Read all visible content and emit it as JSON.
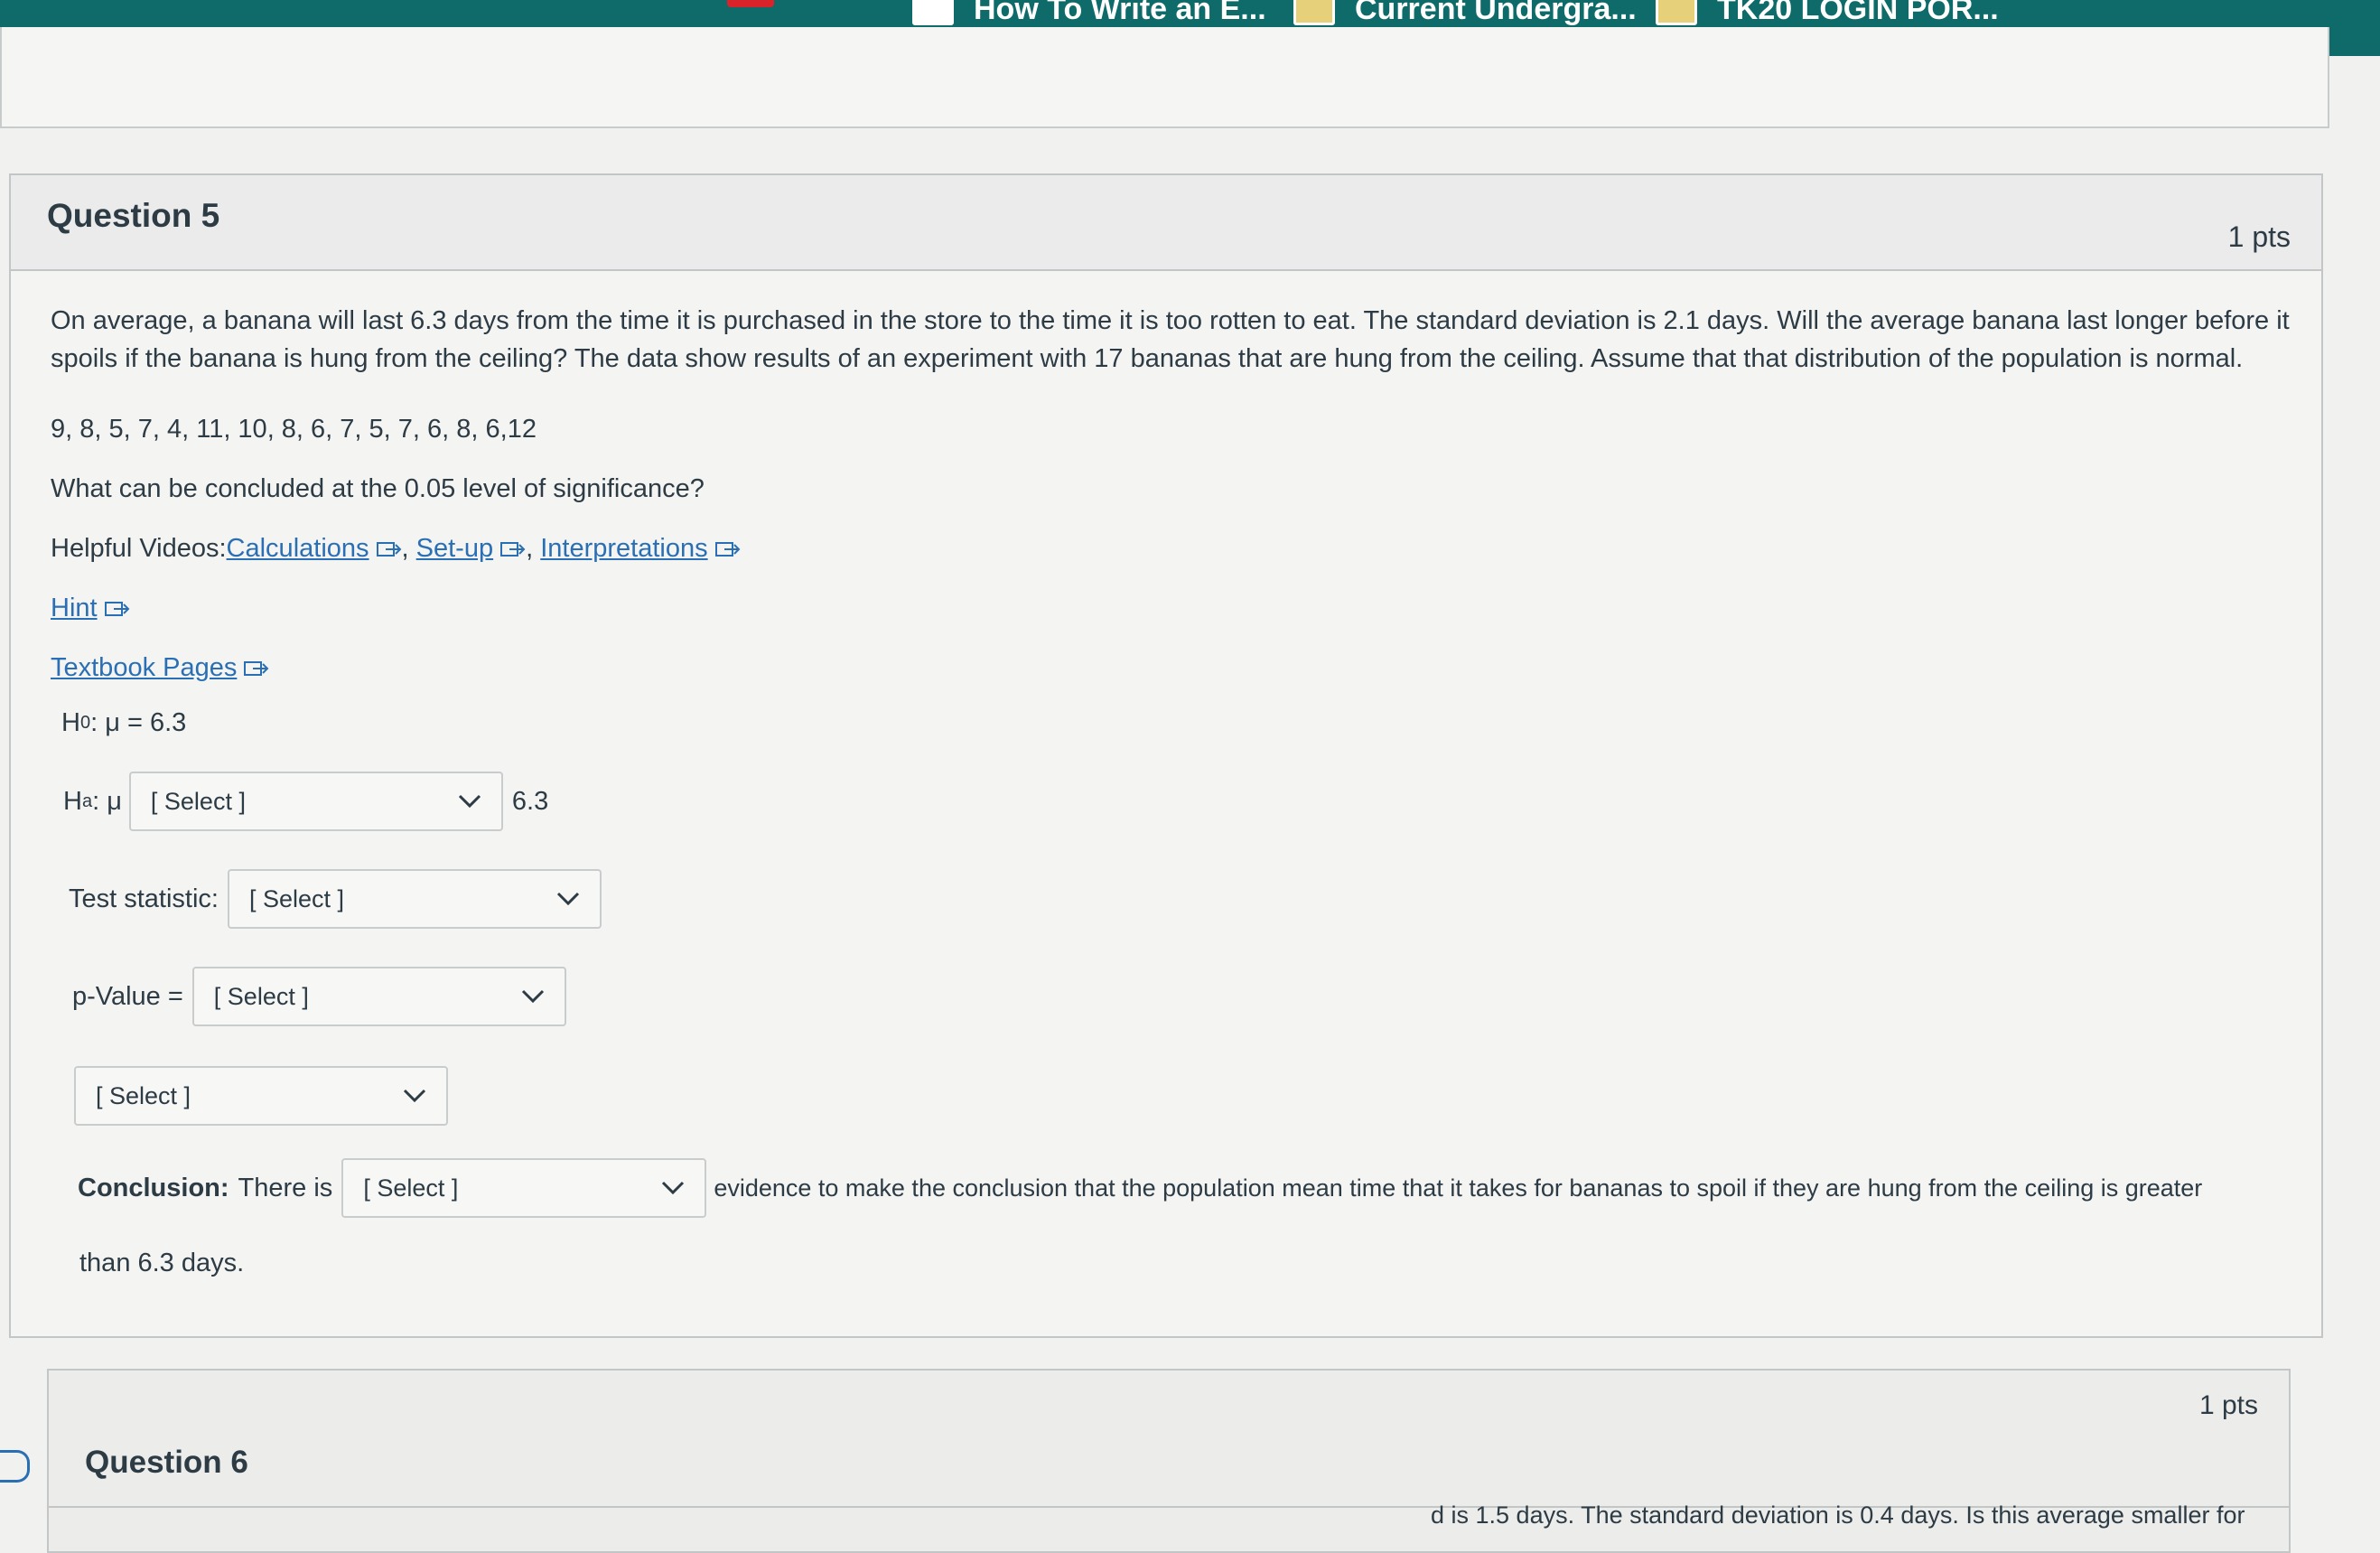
{
  "browser": {
    "bookmarks": [
      {
        "label": "How To Write an E...",
        "icon": "white-square"
      },
      {
        "label": "Current Undergra...",
        "icon": "folder-icon"
      },
      {
        "label": "TK20 LOGIN POR...",
        "icon": "folder-icon"
      }
    ]
  },
  "question5": {
    "title": "Question 5",
    "points": "1 pts",
    "prompt": "On average, a banana will last 6.3 days from the time it is purchased in the store to the time it is too rotten to eat. The standard deviation is 2.1 days. Will the average banana last longer before it spoils if the banana is hung from the ceiling? The data show results of an experiment with 17 bananas that are hung from the ceiling. Assume that that distribution of the population is normal.",
    "data_values": "9, 8, 5, 7, 4, 11, 10, 8, 6, 7, 5, 7, 6, 8, 6,12",
    "significance_question": "What can be concluded at the 0.05 level of significance?",
    "helpful_videos_label": "Helpful Videos:",
    "videos": [
      "Calculations",
      "Set-up",
      "Interpretations"
    ],
    "hint": "Hint",
    "textbook": "Textbook Pages",
    "h0": {
      "label": "H",
      "sub": "0",
      "rest": ": μ = 6.3"
    },
    "ha": {
      "label": "H",
      "sub": "a",
      "rest": ": μ",
      "select": "[ Select ]",
      "value": "6.3"
    },
    "test_statistic": {
      "label": "Test statistic:",
      "select": "[ Select ]"
    },
    "p_value": {
      "label": "p-Value =",
      "select": "[ Select ]"
    },
    "decision": {
      "select": "[ Select ]"
    },
    "conclusion": {
      "label": "Conclusion:",
      "prefix": "There is",
      "select": "[ Select ]",
      "suffix": "evidence to make the conclusion that the population mean time that it takes for bananas to spoil if they are hung from the ceiling is greater",
      "tail": "than 6.3 days."
    }
  },
  "question6": {
    "title": "Question 6",
    "points": "1 pts",
    "text_fragment": "d is 1.5 days. The standard deviation is 0.4 days. Is this average smaller for"
  }
}
